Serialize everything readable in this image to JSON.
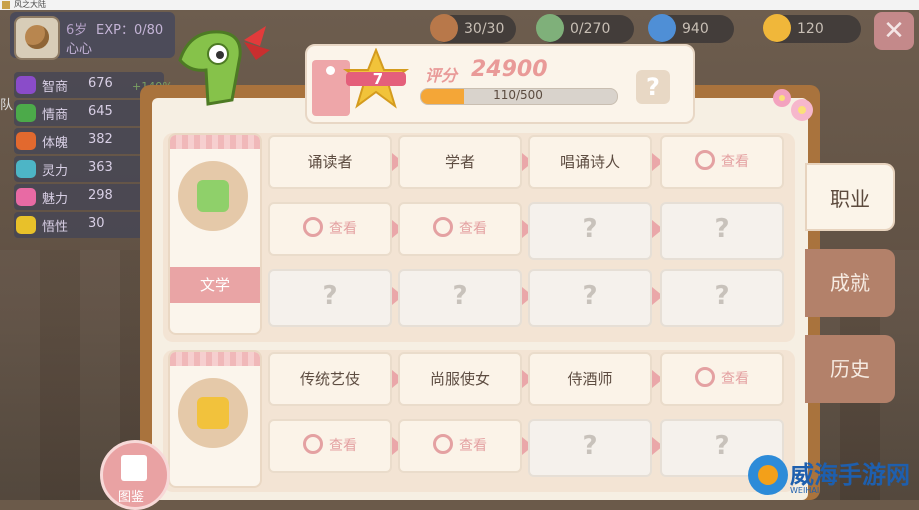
{
  "window": {
    "title": "风之大陆"
  },
  "character": {
    "age": "6岁",
    "exp": "EXP：0/80",
    "name": "心心",
    "side_label": "队"
  },
  "stats": [
    {
      "name": "智商",
      "value": "676",
      "color": "#8a4cc9"
    },
    {
      "name": "情商",
      "value": "645",
      "color": "#4caa4a"
    },
    {
      "name": "体魄",
      "value": "382",
      "color": "#e2692e"
    },
    {
      "name": "灵力",
      "value": "363",
      "color": "#4db5c6"
    },
    {
      "name": "魅力",
      "value": "298",
      "color": "#e86aa4"
    },
    {
      "name": "悟性",
      "value": "30",
      "color": "#e8c12a"
    }
  ],
  "stat_bonus": "+140%",
  "resources": [
    {
      "icon": "bread-icon",
      "value": "30/30",
      "color": "#b8784a"
    },
    {
      "icon": "feather-icon",
      "value": "0/270",
      "color": "#7fb07a"
    },
    {
      "icon": "lightning-icon",
      "value": "940",
      "color": "#4f8fd6"
    },
    {
      "icon": "smiley-coin-icon",
      "value": "120",
      "color": "#f0b73a"
    }
  ],
  "close_label": "✕",
  "header": {
    "level": "7",
    "score_label": "评分",
    "score_value": "24900",
    "progress_text": "110/500",
    "progress_fraction": 0.22,
    "help_label": "?"
  },
  "categories": [
    {
      "name": "文学",
      "rows": [
        [
          {
            "type": "job",
            "label": "诵读者"
          },
          {
            "type": "job",
            "label": "学者"
          },
          {
            "type": "job",
            "label": "唱诵诗人"
          },
          {
            "type": "view",
            "label": "查看"
          }
        ],
        [
          {
            "type": "view",
            "label": "查看"
          },
          {
            "type": "view",
            "label": "查看"
          },
          {
            "type": "unknown",
            "label": "?"
          },
          {
            "type": "unknown",
            "label": "?"
          }
        ],
        [
          {
            "type": "unknown",
            "label": "?"
          },
          {
            "type": "unknown",
            "label": "?"
          },
          {
            "type": "unknown",
            "label": "?"
          },
          {
            "type": "unknown",
            "label": "?"
          }
        ]
      ]
    },
    {
      "name": "",
      "rows": [
        [
          {
            "type": "job",
            "label": "传统艺伎"
          },
          {
            "type": "job",
            "label": "尚服使女"
          },
          {
            "type": "job",
            "label": "侍酒师"
          },
          {
            "type": "view",
            "label": "查看"
          }
        ],
        [
          {
            "type": "view",
            "label": "查看"
          },
          {
            "type": "view",
            "label": "查看"
          },
          {
            "type": "unknown",
            "label": "?"
          },
          {
            "type": "unknown",
            "label": "?"
          }
        ]
      ]
    }
  ],
  "tabs": [
    {
      "label": "职业",
      "active": true
    },
    {
      "label": "成就",
      "active": false
    },
    {
      "label": "历史",
      "active": false
    }
  ],
  "book_label": "图鉴",
  "watermark": {
    "text": "威海手游网",
    "sub": "WEIHAI"
  }
}
